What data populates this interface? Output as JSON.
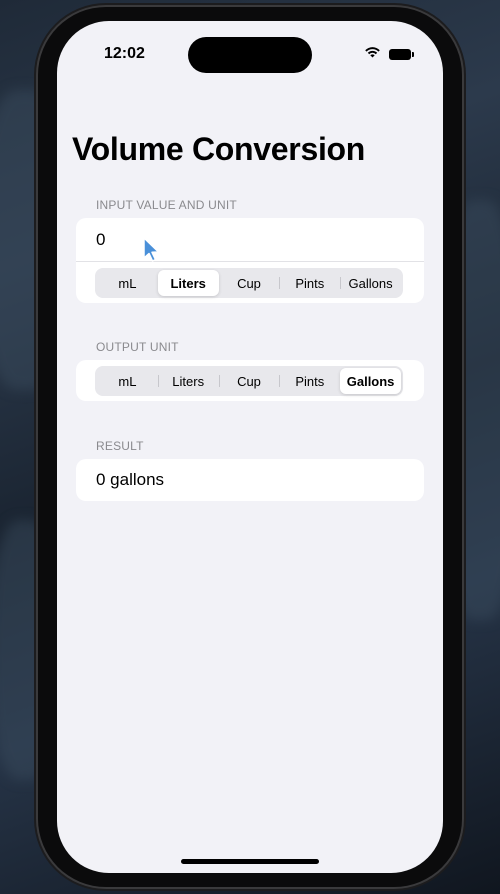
{
  "status_bar": {
    "time": "12:02",
    "wifi_icon": "wifi-icon",
    "battery_icon": "battery-icon"
  },
  "nav": {
    "title": "Volume Conversion"
  },
  "input_section": {
    "header": "INPUT VALUE AND UNIT",
    "value": "0",
    "units": [
      "mL",
      "Liters",
      "Cup",
      "Pints",
      "Gallons"
    ],
    "selected_unit": "Liters"
  },
  "output_section": {
    "header": "OUTPUT UNIT",
    "units": [
      "mL",
      "Liters",
      "Cup",
      "Pints",
      "Gallons"
    ],
    "selected_unit": "Gallons"
  },
  "result_section": {
    "header": "RESULT",
    "value": "0 gallons"
  },
  "colors": {
    "background": "#f2f2f7",
    "card": "#ffffff",
    "section_header": "#8a8a8e",
    "cursor": "#4a90d9"
  }
}
